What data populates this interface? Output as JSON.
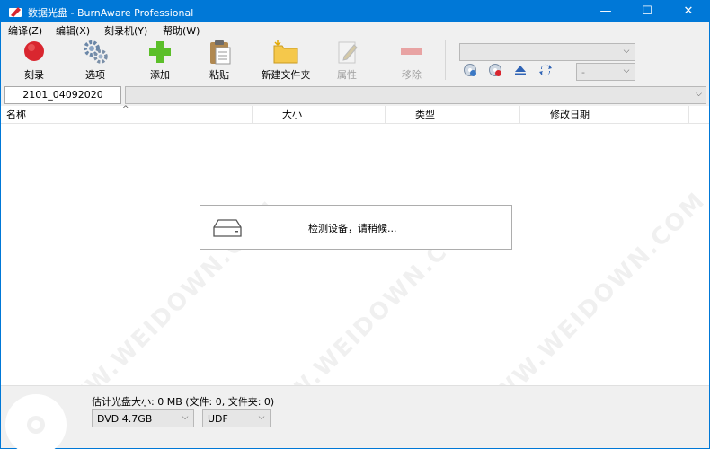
{
  "window": {
    "title": "数据光盘 - BurnAware Professional",
    "controls": {
      "minimize": "—",
      "maximize": "☐",
      "close": "✕"
    }
  },
  "menu": [
    "编译(Z)",
    "编辑(X)",
    "刻录机(Y)",
    "帮助(W)"
  ],
  "toolbar": {
    "burn": "刻录",
    "options": "选项",
    "add": "添加",
    "paste": "粘贴",
    "new_folder": "新建文件夹",
    "properties": "属性",
    "remove": "移除"
  },
  "path": {
    "disc_label": "2101_04092020"
  },
  "columns": {
    "name": "名称",
    "size": "大小",
    "type": "类型",
    "modified": "修改日期"
  },
  "dialog": {
    "message": "检测设备，请稍候..."
  },
  "status": {
    "estimate": "估计光盘大小: 0 MB (文件: 0, 文件夹: 0)",
    "disc_type": "DVD 4.7GB",
    "file_system": "UDF"
  },
  "watermark_text": "WWW.WEIDOWN.COM",
  "colors": {
    "titlebar": "#0078d7",
    "burn_red": "#d9262f",
    "add_green": "#5cbf2a",
    "folder_yellow": "#f5c84b"
  }
}
